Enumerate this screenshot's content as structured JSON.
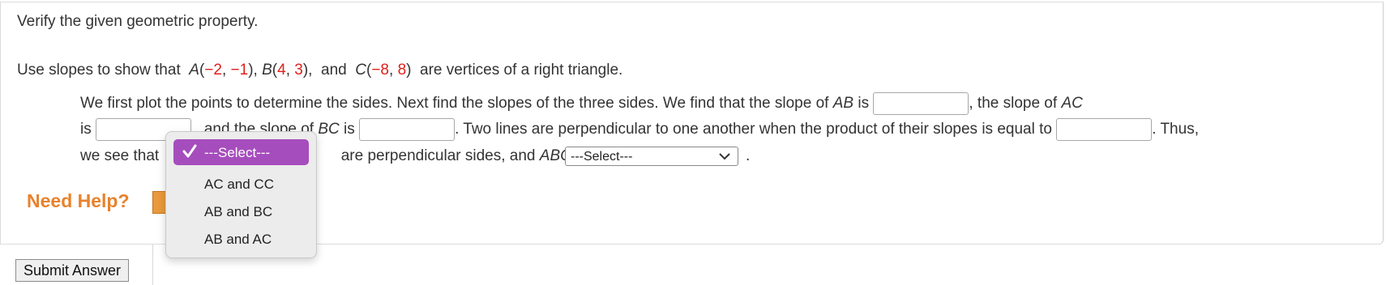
{
  "prompt": "Verify the given geometric property.",
  "problem": {
    "lead": "Use slopes to show that",
    "A": {
      "label": "A",
      "x": "−2",
      "y": "−1"
    },
    "B": {
      "label": "B",
      "x": "4",
      "y": "3"
    },
    "C": {
      "label": "C",
      "x": "−8",
      "y": "8"
    },
    "and": "and",
    "tail": "are vertices of a right triangle."
  },
  "body": {
    "l1_a": "We first plot the points to determine the sides. Next find the slopes of the three sides. We find that the slope of",
    "seg_AB": "AB",
    "is": "is",
    "l1_b": ", the slope of",
    "seg_AC": "AC",
    "l2_a": "and the slope of",
    "seg_BC": "BC",
    "l2_b": ". Two lines are perpendicular to one another when the product of their slopes is equal to",
    "l2_c": ". Thus,",
    "l3_a": "we see that",
    "l3_b": "are perpendicular sides, and",
    "tri": "ABC",
    "period": "."
  },
  "select_closed": "---Select---",
  "dropdown": {
    "selected": "---Select---",
    "options": [
      "AC and CC",
      "AB and BC",
      "AB and AC"
    ]
  },
  "help": "Need Help?",
  "submit": "Submit Answer",
  "colors": {
    "accent": "#a64dbd",
    "help": "#e8822c",
    "red": "#e0201b"
  },
  "icons": {
    "check": "check-icon",
    "chevron": "chevron-down-icon"
  }
}
